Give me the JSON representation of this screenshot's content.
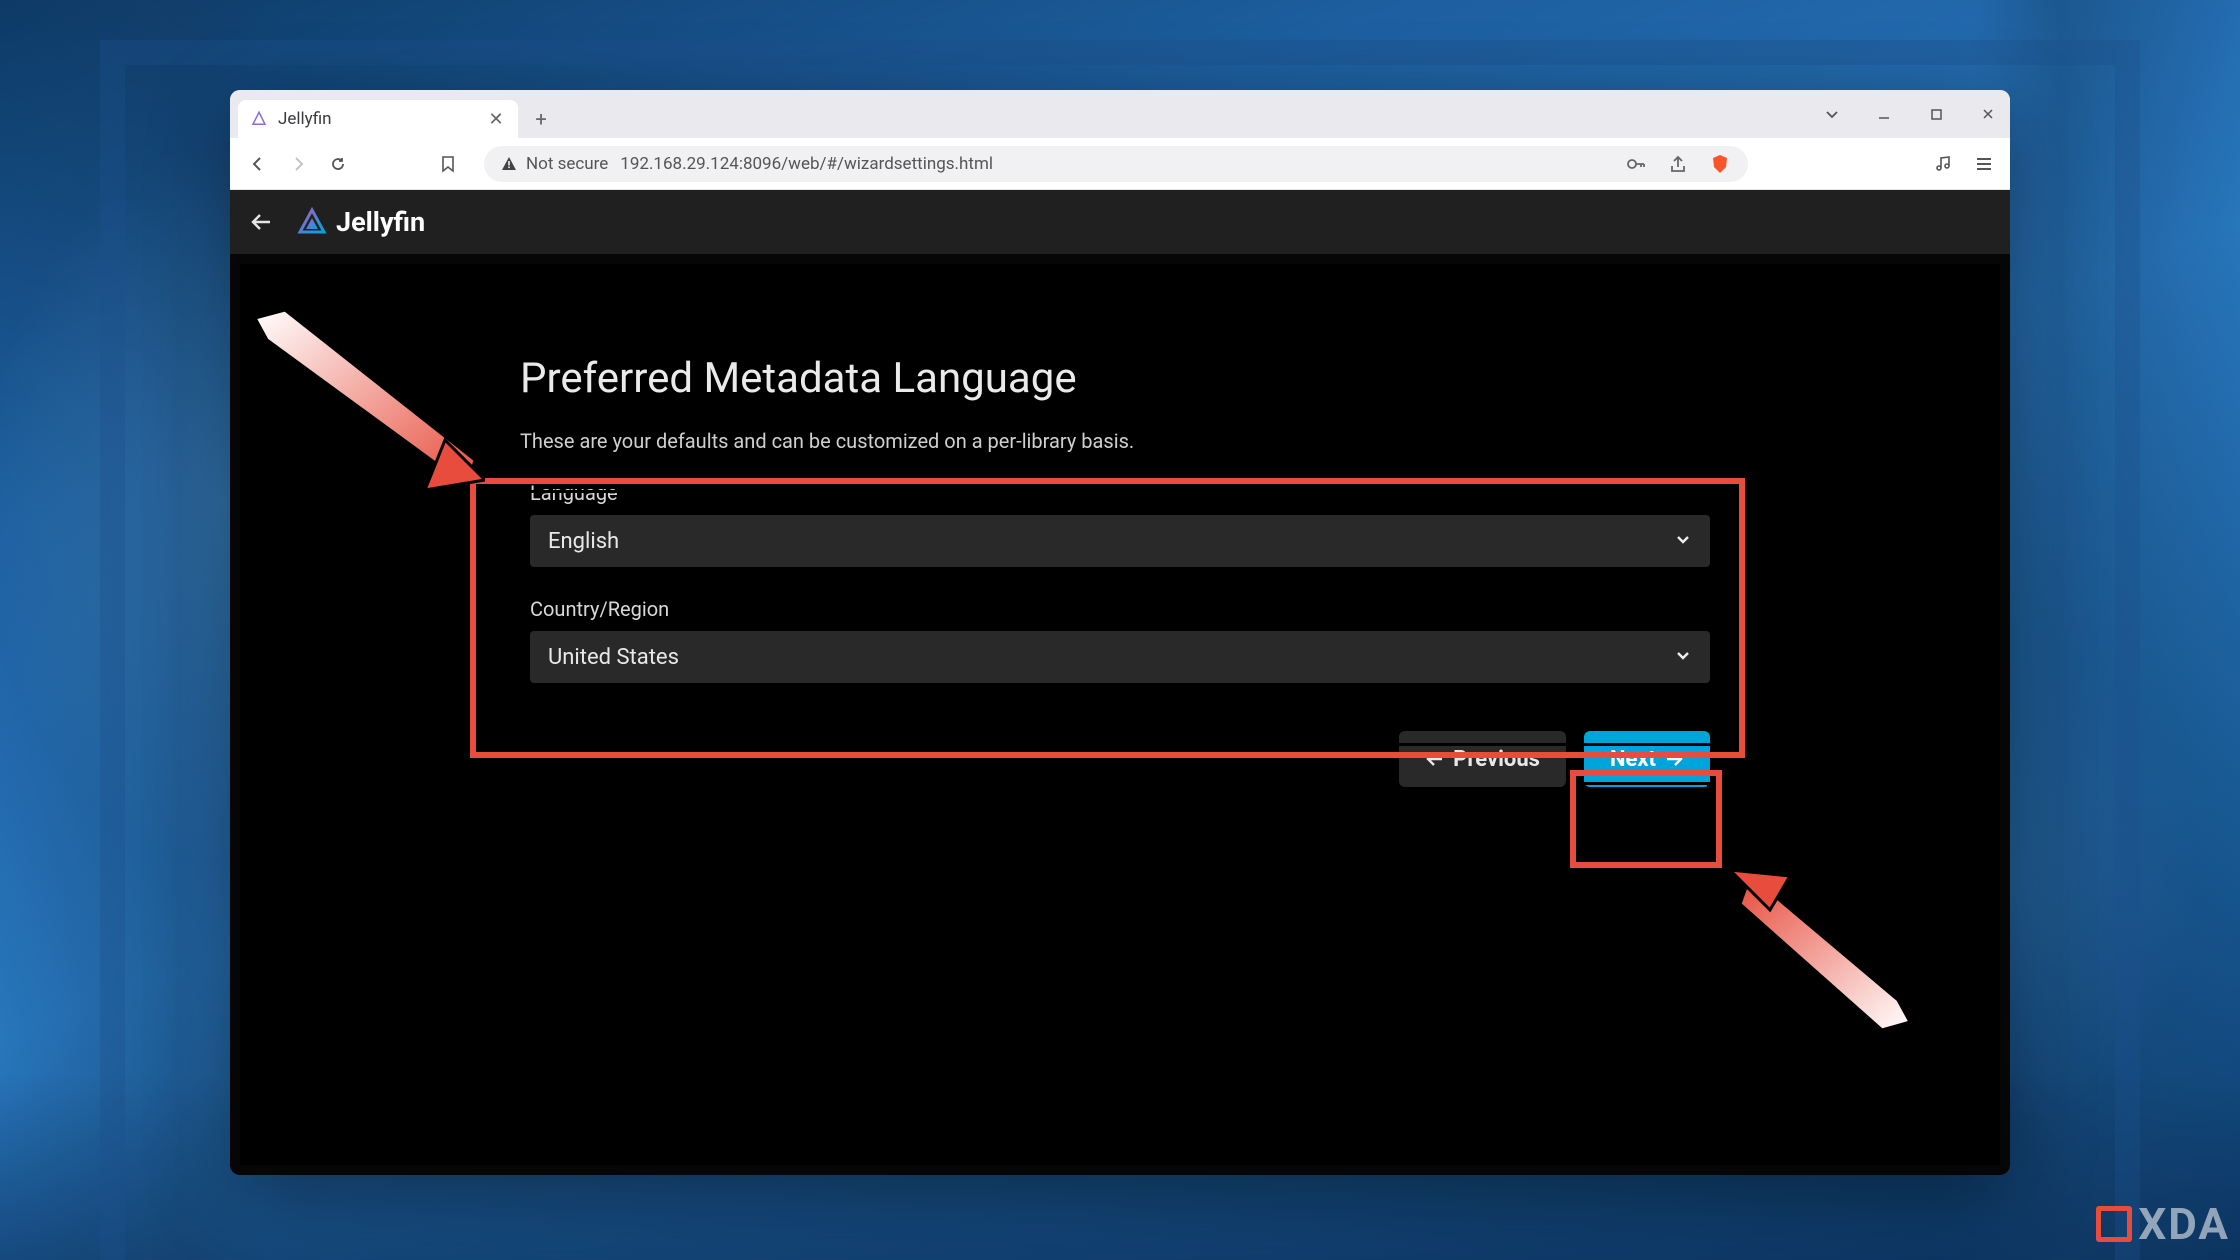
{
  "browser": {
    "tab_title": "Jellyfin",
    "security_label": "Not secure",
    "url": "192.168.29.124:8096/web/#/wizardsettings.html"
  },
  "app": {
    "brand": "Jellyfin",
    "page_title": "Preferred Metadata Language",
    "subtitle": "These are your defaults and can be customized on a per-library basis.",
    "fields": {
      "language_label": "Language",
      "language_value": "English",
      "country_label": "Country/Region",
      "country_value": "United States"
    },
    "buttons": {
      "previous": "Previous",
      "next": "Next"
    }
  },
  "watermark": "XDA"
}
